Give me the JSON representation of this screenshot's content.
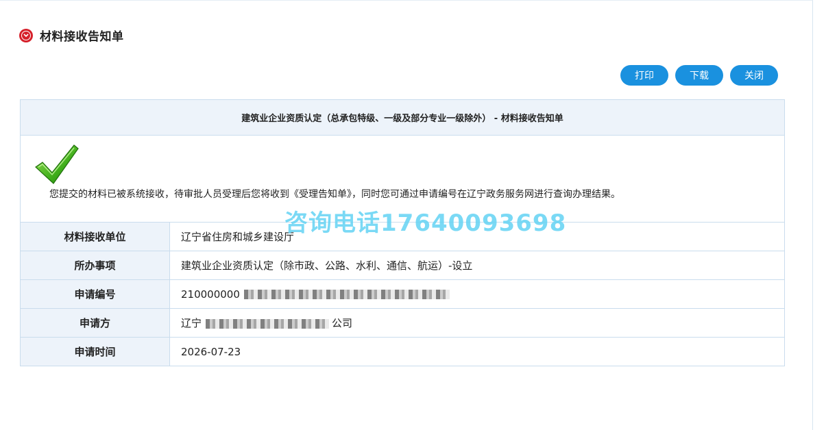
{
  "header": {
    "title": "材料接收告知单"
  },
  "toolbar": {
    "print_label": "打印",
    "download_label": "下载",
    "close_label": "关闭"
  },
  "notice": {
    "heading": "建筑业企业资质认定（总承包特级、一级及部分专业一级除外） - 材料接收告知单",
    "message": "您提交的材料已被系统接收，待审批人员受理后您将收到《受理告知单》，同时您可通过申请编号在辽宁政务服务网进行查询办理结果。",
    "watermark": "咨询电话17640093698"
  },
  "info_rows": [
    {
      "label": "材料接收单位",
      "value": "辽宁省住房和城乡建设厅"
    },
    {
      "label": "所办事项",
      "value": "建筑业企业资质认定（除市政、公路、水利、通信、航运）-设立"
    },
    {
      "label": "申请编号",
      "value": "210000000"
    },
    {
      "label": "申请方",
      "value_prefix": "辽宁",
      "value_suffix": "公司"
    },
    {
      "label": "申请时间",
      "value": "2026-07-23"
    }
  ],
  "colors": {
    "accent": "#1a91df",
    "title_icon": "#d6202a",
    "watermark": "#63d3f4",
    "table_header_bg": "#edf3fa"
  }
}
